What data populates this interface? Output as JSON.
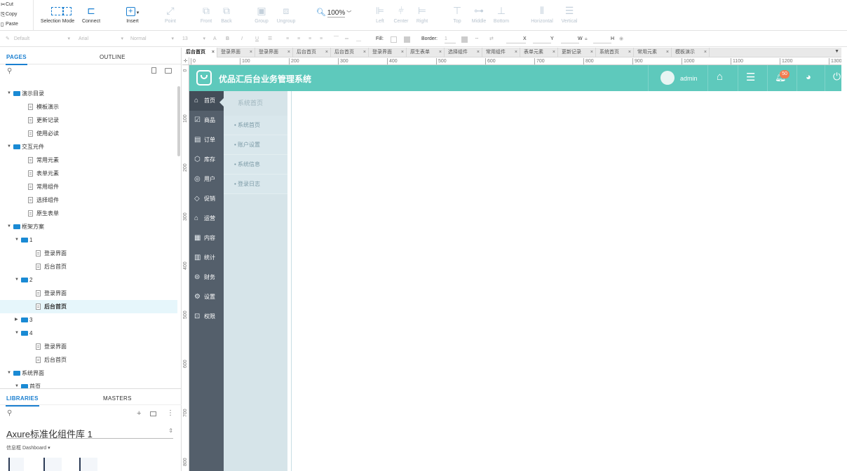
{
  "clipboard": {
    "cut": "Cut",
    "copy": "Copy",
    "paste": "Paste"
  },
  "toolbar": {
    "selection_mode": "Selection Mode",
    "connect": "Connect",
    "insert": "Insert",
    "point": "Point",
    "front": "Front",
    "back": "Back",
    "group": "Group",
    "ungroup": "Ungroup",
    "zoom": "100%",
    "left": "Left",
    "center": "Center",
    "right": "Right",
    "top": "Top",
    "middle": "Middle",
    "bottom": "Bottom",
    "horizontal": "Horizontal",
    "vertical": "Vertical"
  },
  "format": {
    "style": "Default",
    "font": "Arial",
    "weight": "Normal",
    "size": "13",
    "fill_label": "Fill:",
    "border_label": "Border:",
    "border_value": "1",
    "x_label": "X",
    "y_label": "Y",
    "w_label": "W",
    "h_label": "H"
  },
  "panel": {
    "pages_tab": "PAGES",
    "outline_tab": "OUTLINE",
    "libraries_tab": "LIBRARIES",
    "masters_tab": "MASTERS",
    "library_name": "Axure标准化组件库 1",
    "library_sub": "信息框 Dashboard ▾"
  },
  "tree": [
    {
      "level": 0,
      "type": "folder",
      "open": true,
      "label": "演示目录"
    },
    {
      "level": 1,
      "type": "page",
      "label": "模板演示"
    },
    {
      "level": 1,
      "type": "page",
      "label": "更新记录"
    },
    {
      "level": 1,
      "type": "page",
      "label": "使用必读"
    },
    {
      "level": 0,
      "type": "folder",
      "open": true,
      "label": "交互元件"
    },
    {
      "level": 1,
      "type": "page",
      "label": "常用元素"
    },
    {
      "level": 1,
      "type": "page",
      "label": "表单元素"
    },
    {
      "level": 1,
      "type": "page",
      "label": "常用组件"
    },
    {
      "level": 1,
      "type": "page",
      "label": "选择组件"
    },
    {
      "level": 1,
      "type": "page",
      "label": "原生表单"
    },
    {
      "level": 0,
      "type": "folder",
      "open": true,
      "label": "框架方案"
    },
    {
      "level": 1,
      "type": "folder",
      "open": true,
      "label": "1"
    },
    {
      "level": 2,
      "type": "page",
      "label": "登录界面"
    },
    {
      "level": 2,
      "type": "page",
      "label": "后台首页"
    },
    {
      "level": 1,
      "type": "folder",
      "open": true,
      "label": "2"
    },
    {
      "level": 2,
      "type": "page",
      "label": "登录界面"
    },
    {
      "level": 2,
      "type": "page",
      "label": "后台首页",
      "selected": true
    },
    {
      "level": 1,
      "type": "folder",
      "open": false,
      "label": "3"
    },
    {
      "level": 1,
      "type": "folder",
      "open": true,
      "label": "4"
    },
    {
      "level": 2,
      "type": "page",
      "label": "登录界面"
    },
    {
      "level": 2,
      "type": "page",
      "label": "后台首页"
    },
    {
      "level": 0,
      "type": "folder",
      "open": true,
      "label": "系统界面"
    },
    {
      "level": 1,
      "type": "folder",
      "open": true,
      "label": "首页"
    }
  ],
  "doc_tabs": [
    "后台首页",
    "登录界面",
    "登录界面",
    "后台首页",
    "后台首页",
    "登录界面",
    "原生表单",
    "选择组件",
    "常用组件",
    "表单元素",
    "更新记录",
    "系统首页",
    "常用元素",
    "模板演示"
  ],
  "ruler_h": [
    "0",
    "100",
    "200",
    "300",
    "400",
    "500",
    "600",
    "700",
    "800",
    "900",
    "1000",
    "1100",
    "1200",
    "1300"
  ],
  "ruler_v": [
    "0",
    "100",
    "200",
    "300",
    "400",
    "500",
    "600",
    "700",
    "800"
  ],
  "mock": {
    "title": "优品汇后台业务管理系统",
    "user": "admin",
    "badge": "50",
    "nav": [
      {
        "icon": "home-icon",
        "glyph": "⌂",
        "label": "首页"
      },
      {
        "icon": "goods-icon",
        "glyph": "☑",
        "label": "商品"
      },
      {
        "icon": "order-icon",
        "glyph": "▤",
        "label": "订单"
      },
      {
        "icon": "stock-icon",
        "glyph": "⬡",
        "label": "库存"
      },
      {
        "icon": "user-icon",
        "glyph": "◎",
        "label": "用户"
      },
      {
        "icon": "promo-icon",
        "glyph": "◇",
        "label": "促销"
      },
      {
        "icon": "ops-icon",
        "glyph": "⌂",
        "label": "运营"
      },
      {
        "icon": "content-icon",
        "glyph": "▦",
        "label": "内容"
      },
      {
        "icon": "stats-icon",
        "glyph": "▥",
        "label": "统计"
      },
      {
        "icon": "finance-icon",
        "glyph": "⊜",
        "label": "财务"
      },
      {
        "icon": "settings-icon",
        "glyph": "⚙",
        "label": "设置"
      },
      {
        "icon": "lock-icon",
        "glyph": "⊡",
        "label": "权限"
      }
    ],
    "sub_header": "系统首页",
    "sub_items": [
      "• 系统首页",
      "• 账户设置",
      "• 系统信息",
      "• 登录日志"
    ]
  },
  "colors": {
    "accent": "#1a7fd0",
    "header": "#5ec9bc",
    "sidebar": "#545f6b",
    "submenu": "#d6e4e9"
  }
}
